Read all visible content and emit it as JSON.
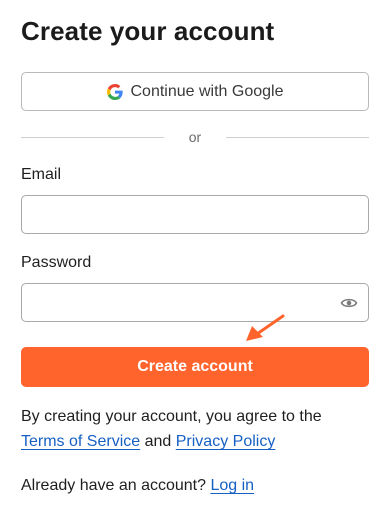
{
  "title": "Create your account",
  "google_button": {
    "label": "Continue with Google",
    "icon": "google-icon"
  },
  "divider_text": "or",
  "email": {
    "label": "Email",
    "value": "",
    "placeholder": ""
  },
  "password": {
    "label": "Password",
    "value": "",
    "placeholder": "",
    "toggle_icon": "eye-icon"
  },
  "create_button": {
    "label": "Create account",
    "color": "#ff642d"
  },
  "annotation": {
    "icon": "arrow-pointer-icon",
    "color": "#ff642d"
  },
  "terms": {
    "prefix": "By creating your account, you agree to the",
    "terms_link": "Terms of Service",
    "conjunction": "and",
    "privacy_link": "Privacy Policy"
  },
  "login": {
    "prompt": "Already have an account?",
    "link": "Log in"
  },
  "colors": {
    "accent": "#ff642d",
    "link": "#1660c4"
  }
}
